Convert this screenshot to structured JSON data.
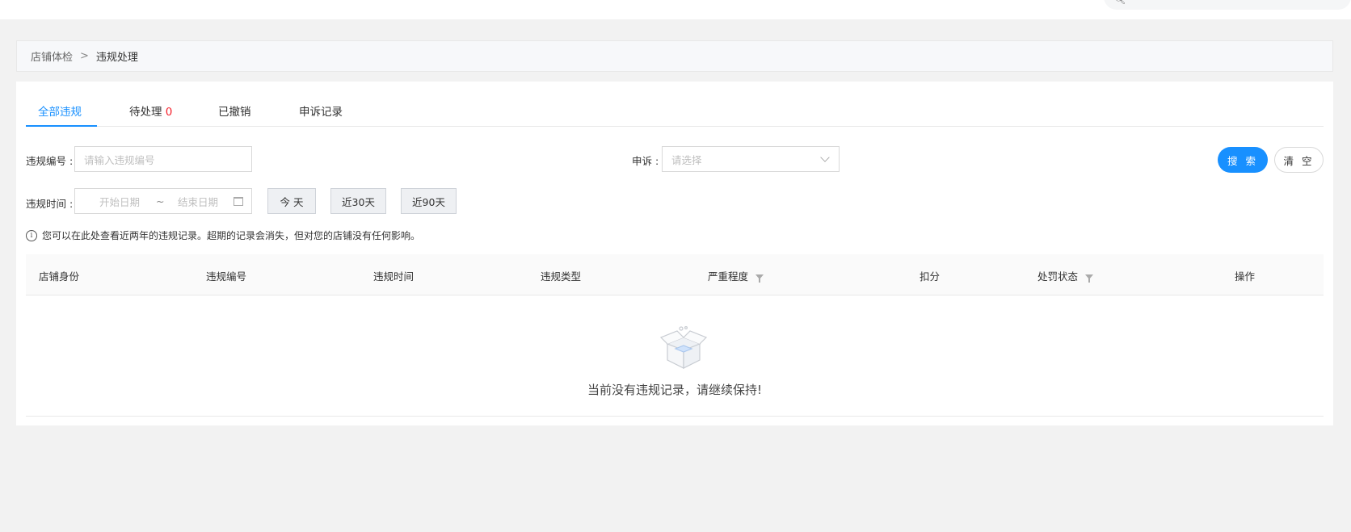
{
  "breadcrumb": {
    "parent": "店铺体检",
    "separator": ">",
    "current": "违规处理"
  },
  "tabs": [
    {
      "label": "全部违规",
      "active": true
    },
    {
      "label": "待处理",
      "count": "0"
    },
    {
      "label": "已撤销"
    },
    {
      "label": "申诉记录"
    }
  ],
  "filters": {
    "violation_no_label": "违规编号 :",
    "violation_no_placeholder": "请输入违规编号",
    "appeal_label": "申诉 :",
    "appeal_placeholder": "请选择",
    "time_label": "违规时间 :",
    "start_date_placeholder": "开始日期",
    "range_separator": "~",
    "end_date_placeholder": "结束日期",
    "quick_today": "今 天",
    "quick_30": "近30天",
    "quick_90": "近90天",
    "search_button": "搜 索",
    "clear_button": "清 空"
  },
  "notice": "您可以在此处查看近两年的违规记录。超期的记录会消失，但对您的店铺没有任何影响。",
  "table": {
    "columns": [
      "店铺身份",
      "违规编号",
      "违规时间",
      "违规类型",
      "严重程度",
      "扣分",
      "处罚状态",
      "操作"
    ]
  },
  "empty_text": "当前没有违规记录，请继续保持!",
  "colors": {
    "accent": "#1890ff",
    "count_red": "#f5222d"
  },
  "icons": {
    "top_search": "search-icon",
    "info": "info-icon",
    "calendar": "calendar-icon",
    "filter": "filter-icon",
    "empty": "empty-box-icon",
    "dropdown": "chevron-down-icon"
  }
}
